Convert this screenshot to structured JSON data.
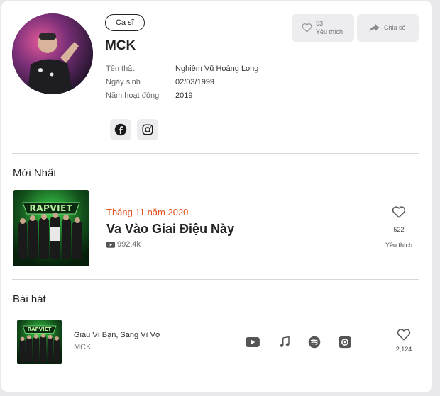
{
  "artist": {
    "badge": "Ca sĩ",
    "name": "MCK",
    "info": [
      {
        "label": "Tên thật",
        "value": "Nghiêm Vũ Hoàng Long"
      },
      {
        "label": "Ngày sinh",
        "value": "02/03/1999"
      },
      {
        "label": "Năm hoạt động",
        "value": "2019"
      }
    ],
    "social": [
      "facebook-icon",
      "instagram-icon"
    ]
  },
  "actions": {
    "like_count": "53",
    "like_label": "Yêu thích",
    "share_label": "Chia sẻ"
  },
  "latest": {
    "section_title": "Mới Nhất",
    "cover_text": "RAPVIET",
    "date": "Tháng 11 năm 2020",
    "title": "Va Vào Giai Điệu Này",
    "views": "992.4k",
    "like_count": "522",
    "like_label": "Yêu thích"
  },
  "songs": {
    "section_title": "Bài hát",
    "items": [
      {
        "title": "Giàu Vì Bạn, Sang Vì Vợ",
        "artist": "MCK",
        "cover_text": "RAPVIET",
        "platforms": [
          "youtube-icon",
          "apple-music-icon",
          "spotify-icon",
          "nhaccuatui-icon"
        ],
        "like_count": "2,124"
      }
    ]
  },
  "colors": {
    "accent_date": "#e2511b",
    "cover_green": "#2ecc40",
    "card_bg": "#ffffff",
    "page_bg": "#e9e9ec"
  }
}
